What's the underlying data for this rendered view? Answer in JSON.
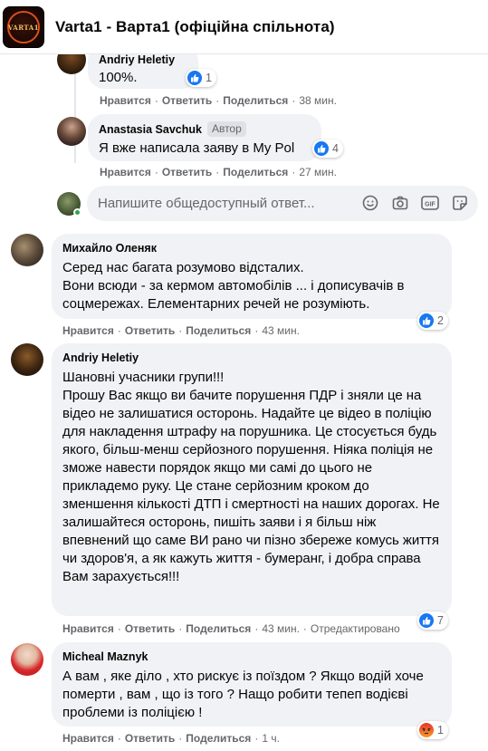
{
  "group": {
    "title": "Varta1 - Варта1 (офіційна спільнота)",
    "logo_text": "VARTA1"
  },
  "action_labels": {
    "like": "Нравится",
    "reply": "Ответить",
    "share": "Поделиться"
  },
  "comments": [
    {
      "author": "Andriy Heletiy",
      "text": "100%.",
      "time": "38 мин.",
      "reaction": {
        "type": "like",
        "count": "1"
      }
    },
    {
      "author": "Anastasia Savchuk",
      "badge": "Автор",
      "text": "Я вже написала заяву в My Pol",
      "time": "27 мин.",
      "reaction": {
        "type": "like",
        "count": "4"
      }
    },
    {
      "author": "Михайло Оленяк",
      "text": "Серед нас багата розумово відсталих.\nВони всюди - за кермом автомобілів ... і дописувачів в соцмережах. Елементарних речей не розуміють.",
      "time": "43 мин.",
      "reaction": {
        "type": "like",
        "count": "2"
      }
    },
    {
      "author": "Andriy Heletiy",
      "text": "Шановні учасники групи!!!\nПрошу Вас якщо ви бачите порушення ПДР і зняли це на відео не залишатися осторонь. Надайте це відео в поліцію для накладення штрафу на порушника. Це стосується будь якого, більш-менш серйозного порушення. Ніяка поліція не зможе навести порядок якщо ми самі до цього не прикладемо руку. Це стане серйозним кроком до зменшення кількості ДТП і смертності на наших дорогах. Не залишайтеся осторонь, пишіть заяви і я більш ніж впевнений що саме ВИ рано чи пізно збереже комусь життя чи здоров'я, а як кажуть життя - бумеранг, і добра справа Вам зарахується!!!",
      "time": "43 мин.",
      "edited": "Отредактировано",
      "reaction": {
        "type": "like",
        "count": "7"
      }
    },
    {
      "author": "Micheal Maznyk",
      "text": "А вам , яке діло , хто рискує із поїздом ? Якщо водій хоче померти , вам , що із того ? Нащо робити тепеп водієві проблеми із поліцією !",
      "time": "1 ч.",
      "reaction": {
        "type": "angry",
        "count": "1"
      }
    }
  ],
  "reply_input": {
    "placeholder": "Напишите общедоступный ответ..."
  },
  "icons": {
    "reply_toolbar": [
      "emoji-icon",
      "camera-icon",
      "gif-icon",
      "sticker-icon"
    ]
  },
  "colors": {
    "accent": "#1877f2",
    "bubble": "#f0f2f5",
    "meta": "#65676b"
  }
}
